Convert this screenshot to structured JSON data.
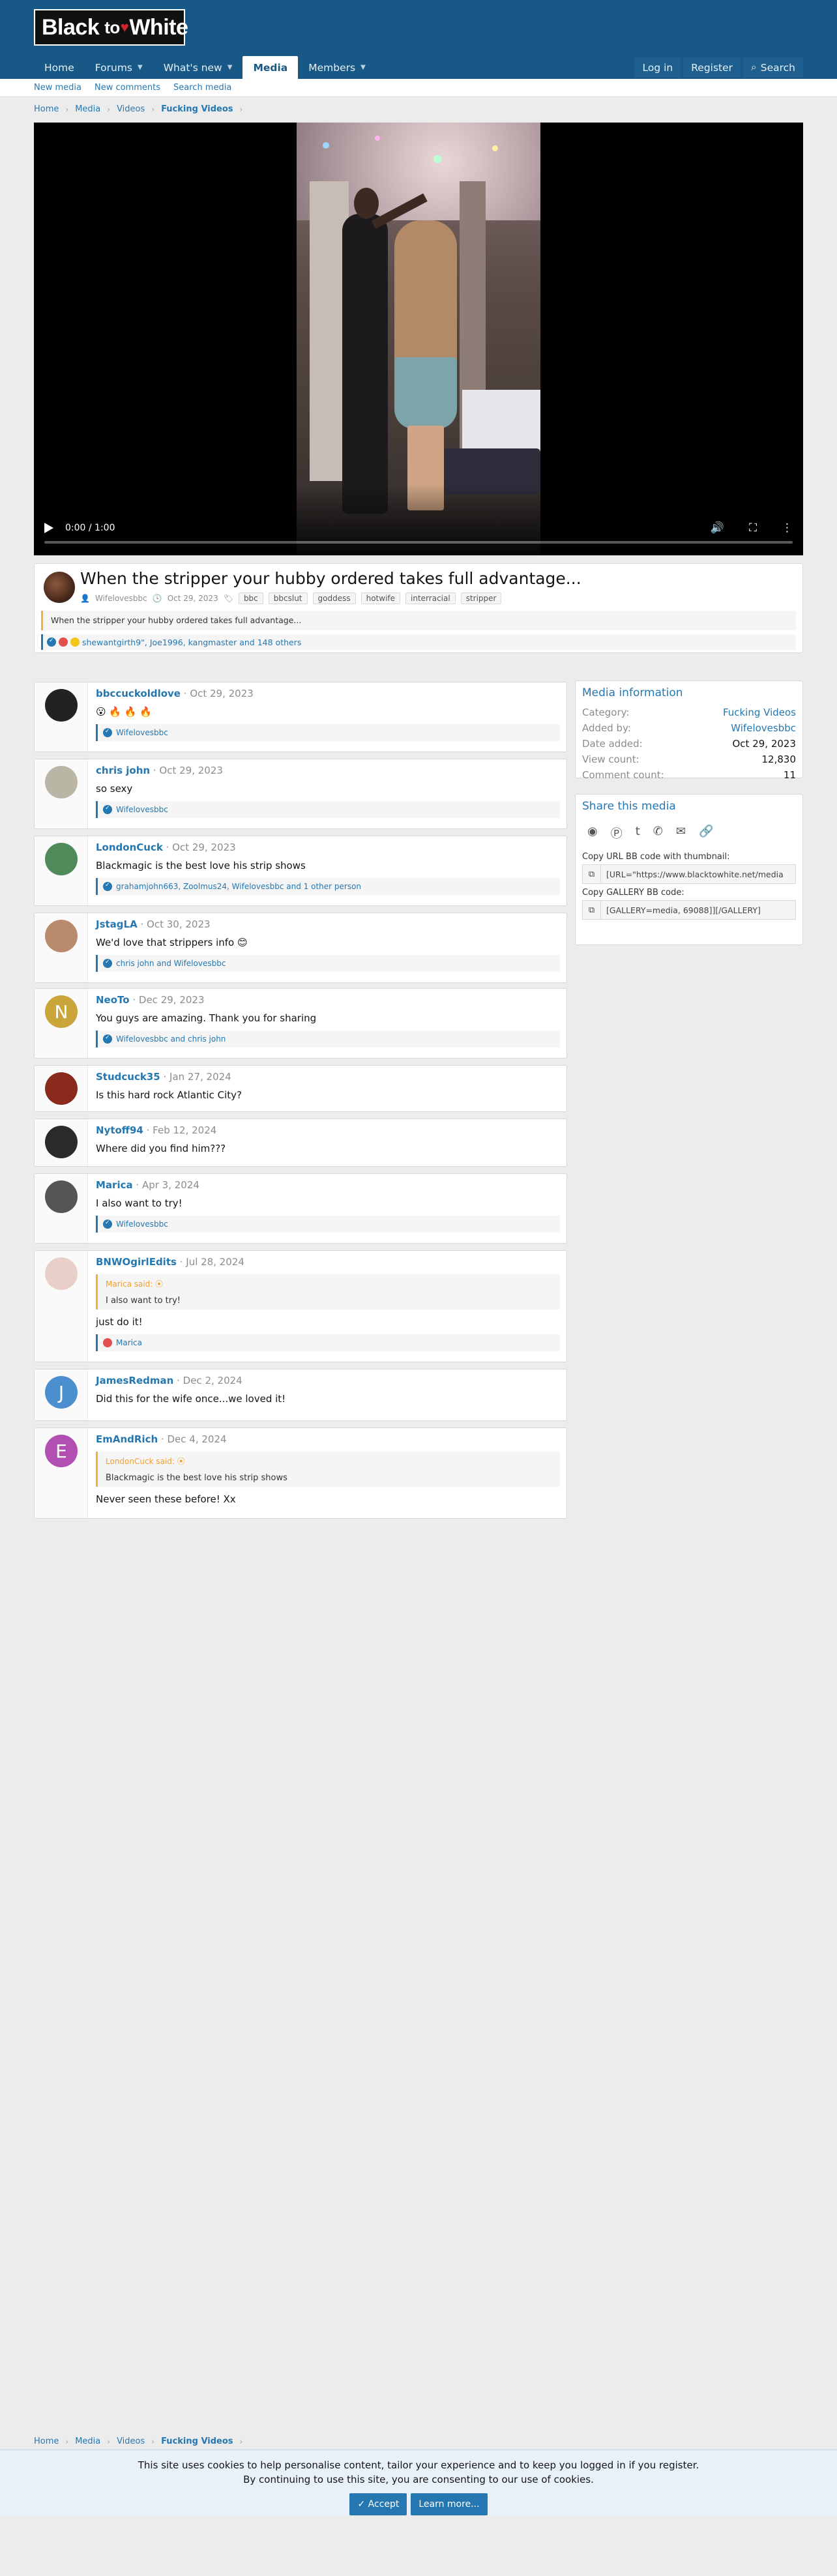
{
  "site": {
    "logo_black": "Black",
    "logo_to": "to",
    "logo_white": "White"
  },
  "nav": {
    "tabs": [
      {
        "label": "Home"
      },
      {
        "label": "Forums"
      },
      {
        "label": "What's new"
      },
      {
        "label": "Media"
      },
      {
        "label": "Members"
      }
    ],
    "login": "Log in",
    "register": "Register",
    "search": "Search"
  },
  "subnav": {
    "items": [
      "New media",
      "New comments",
      "Search media"
    ]
  },
  "breadcrumb": {
    "items": [
      "Home",
      "Media",
      "Videos",
      "Fucking Videos"
    ]
  },
  "video": {
    "time": "0:00 / 1:00",
    "progress": 0
  },
  "media": {
    "title": "When the stripper your hubby ordered takes full advantage...",
    "author": "Wifelovesbbc",
    "date": "Oct 29, 2023",
    "tags": [
      "bbc",
      "bbcslut",
      "goddess",
      "hotwife",
      "interracial",
      "stripper"
    ],
    "description": "When the stripper your hubby ordered takes full advantage...",
    "reactions": "shewantgirth9\", Joe1996, kangmaster and 148 others"
  },
  "comments": [
    {
      "name": "bbccuckoldlove",
      "date": "Oct 29, 2023",
      "text": "😮 🔥 🔥 🔥",
      "reactions": "Wifelovesbbc",
      "avatar_color": "#222222"
    },
    {
      "name": "chris john",
      "date": "Oct 29, 2023",
      "text": "so sexy",
      "reactions": "Wifelovesbbc",
      "avatar_color": "#b9b6a6"
    },
    {
      "name": "LondonCuck",
      "date": "Oct 29, 2023",
      "text": "Blackmagic is the best love his strip shows",
      "reactions": "grahamjohn663, Zoolmus24, Wifelovesbbc and 1 other person",
      "avatar_color": "#4f8a5a"
    },
    {
      "name": "JstagLA",
      "date": "Oct 30, 2023",
      "text": "We'd love that strippers info 😊",
      "reactions": "chris john and Wifelovesbbc",
      "avatar_color": "#b98b6c"
    },
    {
      "name": "NeoTo",
      "date": "Dec 29, 2023",
      "text": "You guys are amazing. Thank you for sharing",
      "reactions": "Wifelovesbbc and chris john",
      "avatar_letter": "N",
      "avatar_color": "#c9a53a"
    },
    {
      "name": "Studcuck35",
      "date": "Jan 27, 2024",
      "text": "Is this hard rock Atlantic City?",
      "avatar_color": "#8a2a1c"
    },
    {
      "name": "Nytoff94",
      "date": "Feb 12, 2024",
      "text": "Where did you find him???",
      "avatar_color": "#2a2a2a"
    },
    {
      "name": "Marica",
      "date": "Apr 3, 2024",
      "text": "I also want to try!",
      "reactions": "Wifelovesbbc",
      "avatar_color": "#555555"
    },
    {
      "name": "BNWOgirlEdits",
      "date": "Jul 28, 2024",
      "quote_author": "Marica said:",
      "quote_text": "I also want to try!",
      "text": "just do it!",
      "reactions": "Marica",
      "avatar_color": "#e8d0c8"
    },
    {
      "name": "JamesRedman",
      "date": "Dec 2, 2024",
      "text": "Did this for the wife once...we loved it!",
      "avatar_letter": "J",
      "avatar_color": "#4b8fcf"
    },
    {
      "name": "EmAndRich",
      "date": "Dec 4, 2024",
      "quote_author": "LondonCuck said:",
      "quote_text": "Blackmagic is the best love his strip shows",
      "text": "Never seen these before! Xx",
      "avatar_letter": "E",
      "avatar_color": "#b24fb2"
    }
  ],
  "info": {
    "heading": "Media information",
    "rows": [
      {
        "k": "Category:",
        "v": "Fucking Videos"
      },
      {
        "k": "Added by:",
        "v": "Wifelovesbbc"
      },
      {
        "k": "Date added:",
        "v": "Oct 29, 2023"
      },
      {
        "k": "View count:",
        "v": "12,830"
      },
      {
        "k": "Comment count:",
        "v": "11"
      }
    ]
  },
  "share": {
    "heading": "Share this media",
    "url_label": "Copy URL BB code with thumbnail:",
    "url_value": "[URL=\"https://www.blacktowhite.net/media",
    "gallery_label": "Copy GALLERY BB code:",
    "gallery_value": "[GALLERY=media, 69088]][/GALLERY]"
  },
  "footer_breadcrumb": {
    "items": [
      "Home",
      "Media",
      "Videos",
      "Fucking Videos"
    ]
  },
  "cookie": {
    "line1": "This site uses cookies to help personalise content, tailor your experience and to keep you logged in if you register.",
    "line2": "By continuing to use this site, you are consenting to our use of cookies.",
    "accept": "Accept",
    "learn": "Learn more..."
  },
  "colors": {
    "header": "#185886",
    "link": "#2577b1",
    "quote_accent": "#f0b43c"
  }
}
